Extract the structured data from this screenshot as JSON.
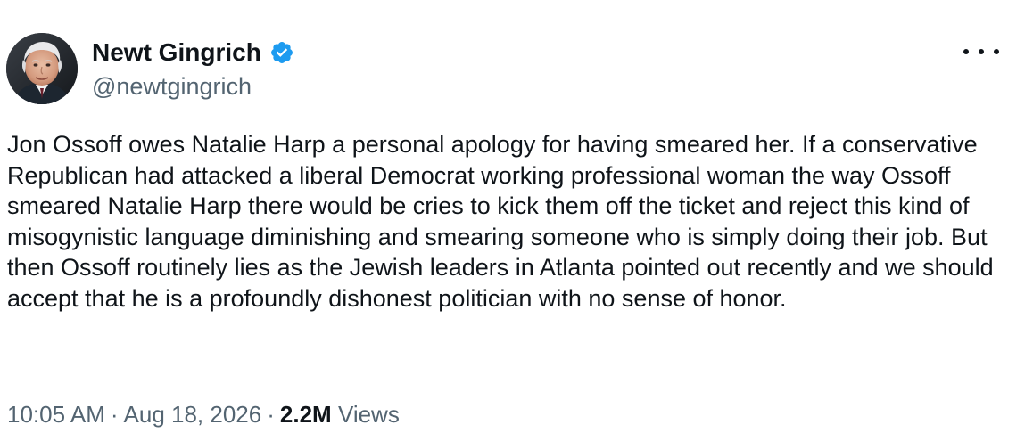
{
  "author": {
    "display_name": "Newt Gingrich",
    "handle": "@newtgingrich",
    "verified": true,
    "verified_icon": "verified-badge-icon",
    "avatar_icon": "profile-photo"
  },
  "more_icon": "more-horizontal-icon",
  "tweet": {
    "text": "Jon Ossoff owes Natalie Harp a personal apology for having smeared her. If a conservative Republican had attacked a liberal Democrat working professional woman the way Ossoff smeared Natalie Harp there would be cries to kick them off the ticket and reject this kind of misogynistic language diminishing and smearing someone who is simply doing their job. But then Ossoff routinely lies as the Jewish leaders in Atlanta pointed out recently and we should accept that he is a profoundly dishonest politician with no sense of honor."
  },
  "meta": {
    "time": "10:05 AM",
    "separator": "·",
    "date": "Aug 18, 2026",
    "views_count": "2.2M",
    "views_label": "Views"
  },
  "colors": {
    "text_primary": "#0f1419",
    "text_secondary": "#536471",
    "verified_blue": "#1d9bf0",
    "background": "#ffffff"
  }
}
